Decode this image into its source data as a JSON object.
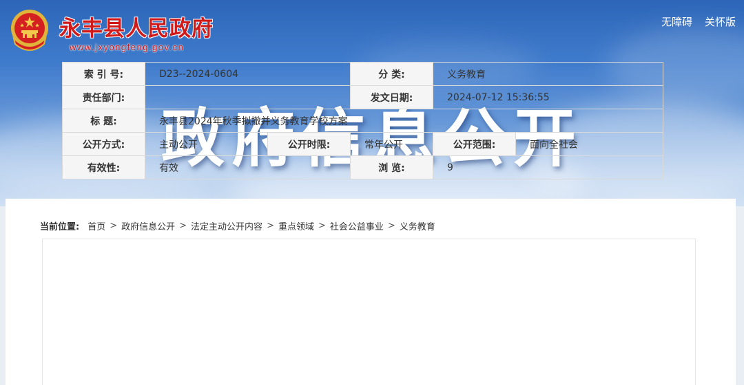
{
  "header": {
    "site_name": "永丰县人民政府",
    "site_url": "www.jxyongfeng.gov.cn",
    "links": [
      "无障碍",
      "关怀版"
    ],
    "banner_title": "政府信息公开"
  },
  "breadcrumb": {
    "label": "当前位置:",
    "items": [
      "首页",
      "政府信息公开",
      "法定主动公开内容",
      "重点领域",
      "社会公益事业",
      "义务教育"
    ],
    "separator": ">"
  },
  "meta": {
    "index_label": "索 引 号:",
    "index_value": "D23--2024-0604",
    "category_label": "分    类:",
    "category_value": "义务教育",
    "dept_label": "责任部门:",
    "dept_value": "",
    "date_label": "发文日期:",
    "date_value": "2024-07-12 15:36:55",
    "title_label": "标    题:",
    "title_value": "永丰县2024年秋季拟撤并义务教育学校方案",
    "mode_label": "公开方式:",
    "mode_value": "主动公开",
    "limit_label": "公开时限:",
    "limit_value": "常年公开",
    "scope_label": "公开范围:",
    "scope_value": "面向全社会",
    "validity_label": "有效性:",
    "validity_value": "有效",
    "views_label": "浏    览:",
    "views_value": "9"
  },
  "colors": {
    "brand_red": "#d01a1a",
    "banner_blue": "#3f7bcc"
  }
}
